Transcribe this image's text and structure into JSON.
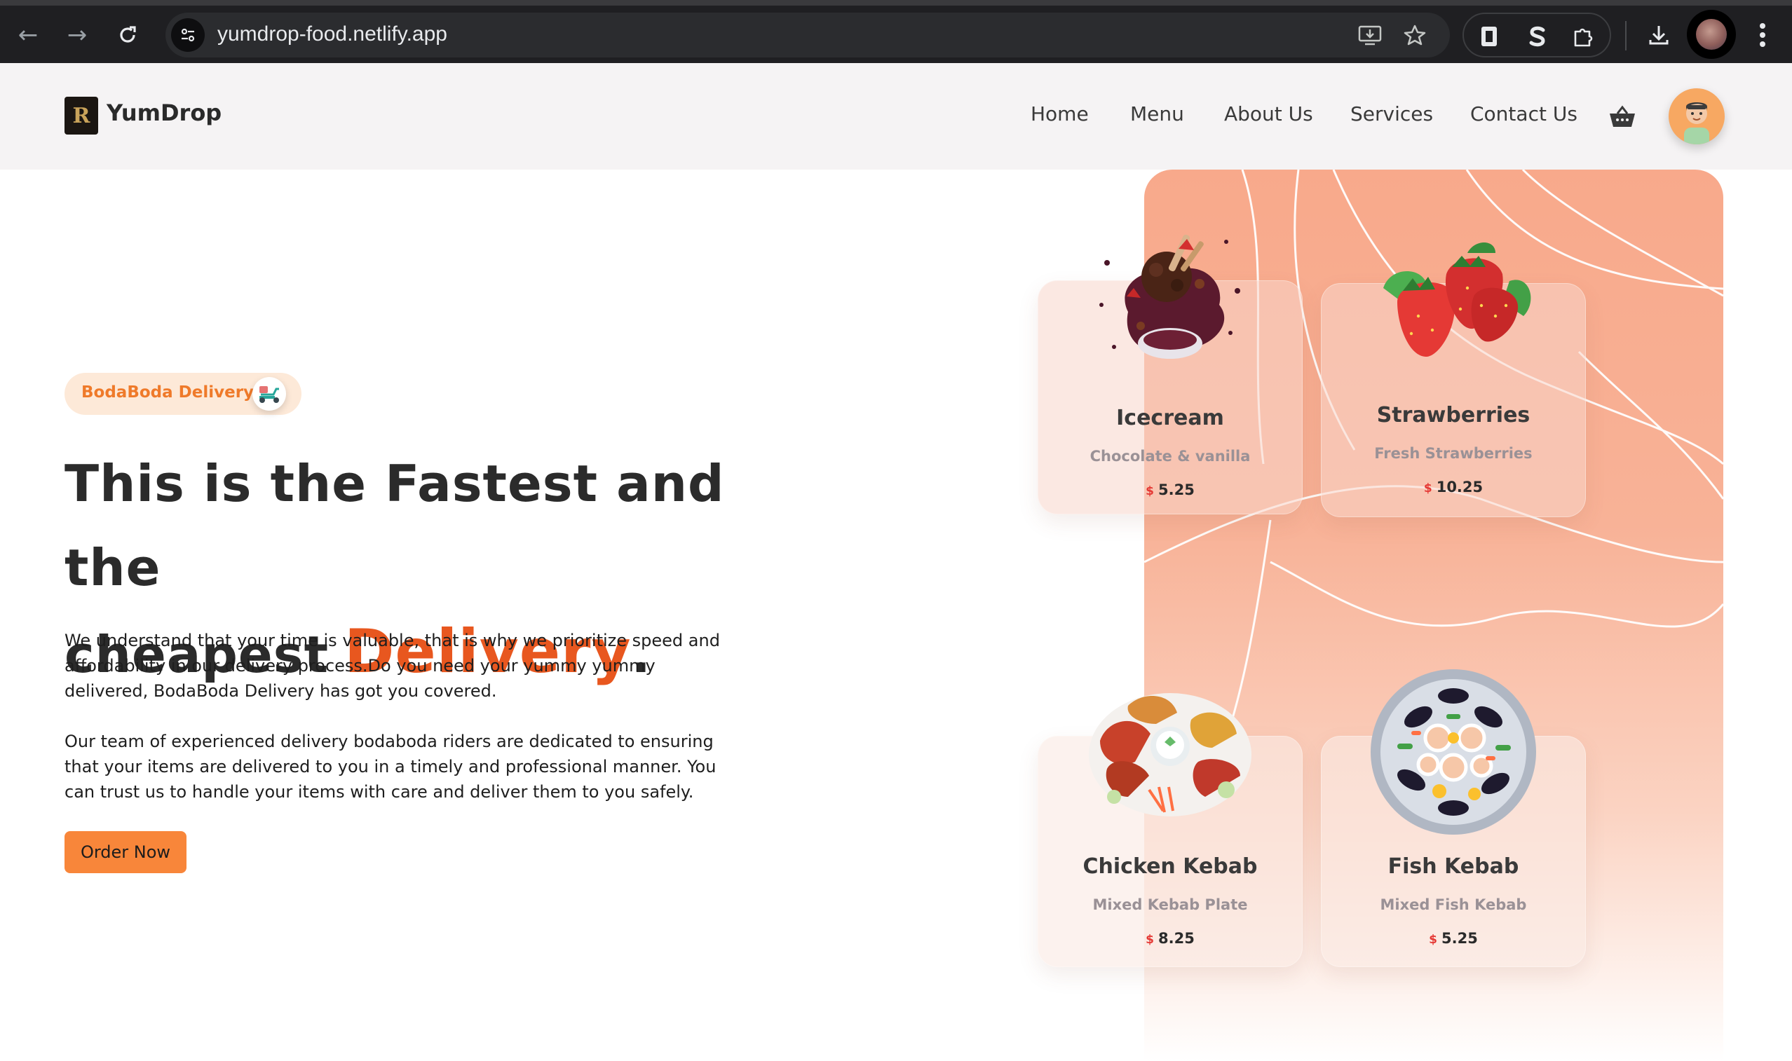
{
  "browser": {
    "url": "yumdrop-food.netlify.app"
  },
  "header": {
    "brand": "YumDrop",
    "logo_letter": "R",
    "nav": [
      "Home",
      "Menu",
      "About Us",
      "Services",
      "Contact Us"
    ]
  },
  "hero": {
    "badge": "BodaBoda Delivery",
    "headline_line1": "This is the Fastest and the",
    "headline_line2": "cheapest",
    "headline_accent": "Delivery",
    "headline_end": ".",
    "paragraph1": "We understand that your time is valuable, that is why we prioritize speed and affordability in our delivery process.Do you need your yummy yummy delivered, BodaBoda Delivery has got you covered.",
    "paragraph2": "Our team of experienced delivery bodaboda riders are dedicated to ensuring that your items are delivered to you in a timely and professional manner. You can trust us to handle your items with care and deliver them to you safely.",
    "cta": "Order Now"
  },
  "menu_cards": [
    {
      "title": "Icecream",
      "subtitle": "Chocolate & vanilla",
      "currency": "$",
      "price": "5.25"
    },
    {
      "title": "Strawberries",
      "subtitle": "Fresh Strawberries",
      "currency": "$",
      "price": "10.25"
    },
    {
      "title": "Chicken Kebab",
      "subtitle": "Mixed Kebab Plate",
      "currency": "$",
      "price": "8.25"
    },
    {
      "title": "Fish Kebab",
      "subtitle": "Mixed Fish Kebab",
      "currency": "$",
      "price": "5.25"
    }
  ],
  "colors": {
    "accent": "#e8571f",
    "button": "#f8863a",
    "badge_bg": "#fde9d8",
    "panel_top": "#f8a98b",
    "price_currency": "#e53935"
  }
}
